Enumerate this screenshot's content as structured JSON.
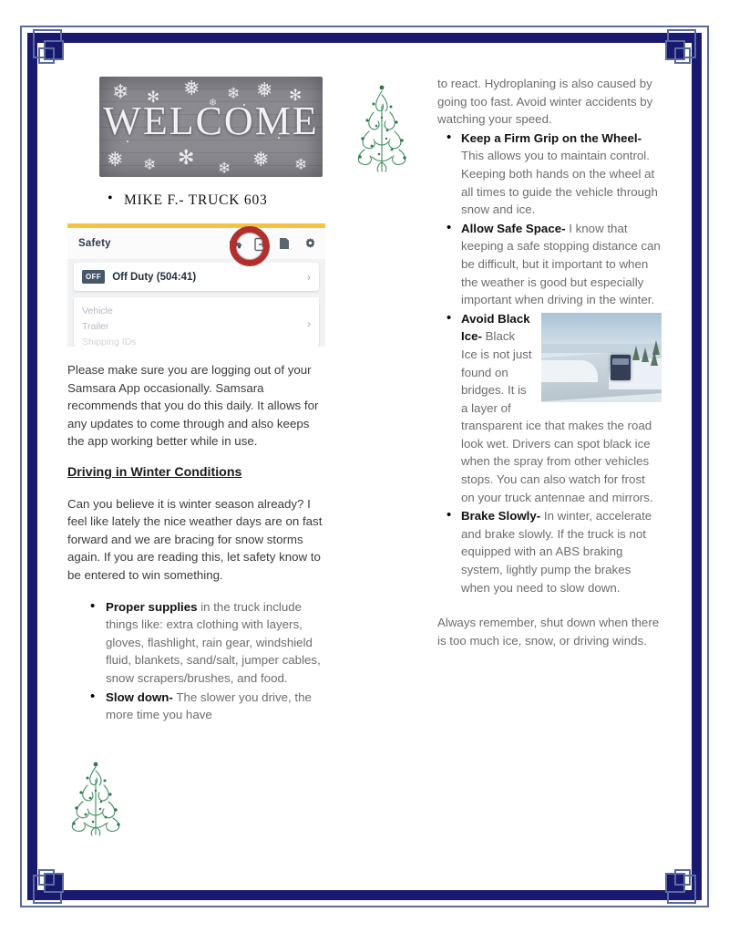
{
  "document": {
    "type": "newsletter-page",
    "border_color": "#191970",
    "border_accent_color": "#5b6b9e"
  },
  "banner": {
    "text": "WELCOME",
    "alt": "welcome-sign-with-snowflakes"
  },
  "driver_line": "MIKE F.- TRUCK 603",
  "samsara_app": {
    "accent_bar_color": "#f5c342",
    "header_title": "Safety",
    "icons": [
      "truck-icon",
      "logout-icon",
      "document-icon",
      "gear-icon"
    ],
    "annotation": {
      "shape": "red-circle",
      "color": "#b0302e",
      "targets": "logout-icon"
    },
    "duty_status": {
      "badge": "OFF",
      "label": "Off Duty (504:41)",
      "chevron": "chevron-right-icon"
    },
    "id_rows": [
      "Vehicle",
      "Trailer",
      "Shipping IDs"
    ]
  },
  "left_column": {
    "paragraph_1": "Please make sure you are logging out of your Samsara App occasionally. Samsara recommends that you do this daily. It allows for any updates to come through and also keeps the app working better while in use.",
    "heading": "Driving in Winter Conditions",
    "paragraph_2": "Can you believe it is winter season already? I feel like lately the nice weather days are on fast forward and we are bracing for snow storms again. If you are reading this, let safety know to be entered to win something.",
    "bullets": [
      {
        "bold": "Proper supplies",
        "rest": " in the truck include things like: extra clothing with layers, gloves, flashlight, rain gear, windshield fluid, blankets, sand/salt, jumper cables, snow scrapers/brushes, and food."
      },
      {
        "bold": "Slow down-",
        "rest": " The slower you drive, the more time you have"
      }
    ]
  },
  "right_column": {
    "continuation": "to react. Hydroplaning is also caused by going too fast. Avoid winter accidents by watching your speed.",
    "bullets": [
      {
        "bold": "Keep a Firm Grip on the Wheel-",
        "rest": " This allows you to maintain control. Keeping both hands on the wheel at all times to guide the vehicle through snow and ice."
      },
      {
        "bold": "Allow Safe Space-",
        "rest": " I know that keeping a safe stopping distance can be difficult, but it important to when the weather is good but especially important when driving in the winter."
      },
      {
        "bold": "Avoid Black Ice-",
        "rest": " Black Ice is not just found on bridges. It is a layer of transparent ice that makes the road look wet. Drivers can spot black ice when the spray from other vehicles stops. You can also watch for frost on your truck antennae and mirrors.",
        "image_alt": "truck-on-snowy-road-photo"
      },
      {
        "bold": "Brake Slowly-",
        "rest": " In winter, accelerate and brake slowly. If the truck is not equipped with an ABS braking system, lightly pump the brakes when you need to slow down."
      }
    ],
    "closing": "Always remember, shut down when there is too much ice, snow, or driving winds."
  },
  "decorations": {
    "tree_color": "#3f8f5e",
    "trees": [
      "christmas-tree-top",
      "christmas-tree-bottom"
    ]
  }
}
